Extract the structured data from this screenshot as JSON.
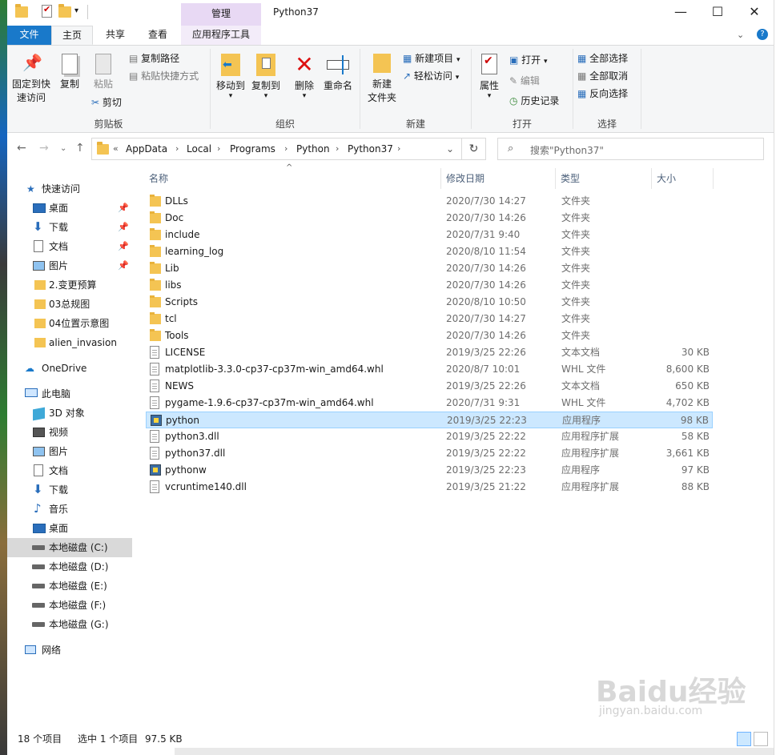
{
  "window": {
    "title": "Python37",
    "context_tab_header": "管理",
    "buttons": {
      "minimize": "—",
      "maximize": "☐",
      "close": "✕"
    }
  },
  "tabs": [
    {
      "label": "文件"
    },
    {
      "label": "主页"
    },
    {
      "label": "共享"
    },
    {
      "label": "查看"
    },
    {
      "label": "应用程序工具"
    }
  ],
  "ribbon": {
    "clipboard": {
      "pin": "固定到快\n速访问",
      "copy": "复制",
      "paste": "粘贴",
      "copy_path": "复制路径",
      "paste_shortcut": "粘贴快捷方式",
      "cut": "剪切",
      "label": "剪贴板"
    },
    "organize": {
      "move_to": "移动到",
      "copy_to": "复制到",
      "delete": "删除",
      "rename": "重命名",
      "label": "组织"
    },
    "new": {
      "new_folder": "新建\n文件夹",
      "new_item": "新建项目",
      "easy_access": "轻松访问",
      "label": "新建"
    },
    "open": {
      "properties": "属性",
      "open": "打开",
      "edit": "编辑",
      "history": "历史记录",
      "label": "打开"
    },
    "select": {
      "select_all": "全部选择",
      "select_none": "全部取消",
      "invert": "反向选择",
      "label": "选择"
    }
  },
  "address": {
    "prefix": "«",
    "crumbs": [
      "AppData",
      "Local",
      "Programs",
      "Python",
      "Python37"
    ],
    "search_placeholder": "搜索\"Python37\""
  },
  "nav": {
    "quick_access": "快速访问",
    "quick_items": [
      {
        "label": "桌面",
        "icon": "desktop-icon",
        "pinned": true
      },
      {
        "label": "下载",
        "icon": "download-icon",
        "pinned": true
      },
      {
        "label": "文档",
        "icon": "document-icon",
        "pinned": true
      },
      {
        "label": "图片",
        "icon": "pictures-icon",
        "pinned": true
      },
      {
        "label": "2.变更预算",
        "icon": "folder-icon",
        "pinned": false
      },
      {
        "label": "03总规图",
        "icon": "folder-icon",
        "pinned": false
      },
      {
        "label": "04位置示意图",
        "icon": "folder-icon",
        "pinned": false
      },
      {
        "label": "alien_invasion",
        "icon": "folder-icon",
        "pinned": false
      }
    ],
    "onedrive": "OneDrive",
    "this_pc": "此电脑",
    "pc_items": [
      {
        "label": "3D 对象",
        "icon": "3d-objects-icon"
      },
      {
        "label": "视频",
        "icon": "video-icon"
      },
      {
        "label": "图片",
        "icon": "pictures-icon"
      },
      {
        "label": "文档",
        "icon": "document-icon"
      },
      {
        "label": "下载",
        "icon": "download-icon"
      },
      {
        "label": "音乐",
        "icon": "music-icon"
      },
      {
        "label": "桌面",
        "icon": "desktop-icon"
      },
      {
        "label": "本地磁盘 (C:)",
        "icon": "drive-icon",
        "selected": true
      },
      {
        "label": "本地磁盘 (D:)",
        "icon": "drive-icon"
      },
      {
        "label": "本地磁盘 (E:)",
        "icon": "drive-icon"
      },
      {
        "label": "本地磁盘 (F:)",
        "icon": "drive-icon"
      },
      {
        "label": "本地磁盘 (G:)",
        "icon": "drive-icon"
      }
    ],
    "network": "网络"
  },
  "columns": {
    "name": "名称",
    "date": "修改日期",
    "type": "类型",
    "size": "大小"
  },
  "files": [
    {
      "name": "DLLs",
      "date": "2020/7/30 14:27",
      "type": "文件夹",
      "size": "",
      "kind": "folder"
    },
    {
      "name": "Doc",
      "date": "2020/7/30 14:26",
      "type": "文件夹",
      "size": "",
      "kind": "folder"
    },
    {
      "name": "include",
      "date": "2020/7/31 9:40",
      "type": "文件夹",
      "size": "",
      "kind": "folder"
    },
    {
      "name": "learning_log",
      "date": "2020/8/10 11:54",
      "type": "文件夹",
      "size": "",
      "kind": "folder"
    },
    {
      "name": "Lib",
      "date": "2020/7/30 14:26",
      "type": "文件夹",
      "size": "",
      "kind": "folder"
    },
    {
      "name": "libs",
      "date": "2020/7/30 14:26",
      "type": "文件夹",
      "size": "",
      "kind": "folder"
    },
    {
      "name": "Scripts",
      "date": "2020/8/10 10:50",
      "type": "文件夹",
      "size": "",
      "kind": "folder"
    },
    {
      "name": "tcl",
      "date": "2020/7/30 14:27",
      "type": "文件夹",
      "size": "",
      "kind": "folder"
    },
    {
      "name": "Tools",
      "date": "2020/7/30 14:26",
      "type": "文件夹",
      "size": "",
      "kind": "folder"
    },
    {
      "name": "LICENSE",
      "date": "2019/3/25 22:26",
      "type": "文本文档",
      "size": "30 KB",
      "kind": "doc"
    },
    {
      "name": "matplotlib-3.3.0-cp37-cp37m-win_amd64.whl",
      "date": "2020/8/7 10:01",
      "type": "WHL 文件",
      "size": "8,600 KB",
      "kind": "doc"
    },
    {
      "name": "NEWS",
      "date": "2019/3/25 22:26",
      "type": "文本文档",
      "size": "650 KB",
      "kind": "doc"
    },
    {
      "name": "pygame-1.9.6-cp37-cp37m-win_amd64.whl",
      "date": "2020/7/31 9:31",
      "type": "WHL 文件",
      "size": "4,702 KB",
      "kind": "doc"
    },
    {
      "name": "python",
      "date": "2019/3/25 22:23",
      "type": "应用程序",
      "size": "98 KB",
      "kind": "exe",
      "selected": true
    },
    {
      "name": "python3.dll",
      "date": "2019/3/25 22:22",
      "type": "应用程序扩展",
      "size": "58 KB",
      "kind": "doc"
    },
    {
      "name": "python37.dll",
      "date": "2019/3/25 22:22",
      "type": "应用程序扩展",
      "size": "3,661 KB",
      "kind": "doc"
    },
    {
      "name": "pythonw",
      "date": "2019/3/25 22:23",
      "type": "应用程序",
      "size": "97 KB",
      "kind": "exe"
    },
    {
      "name": "vcruntime140.dll",
      "date": "2019/3/25 21:22",
      "type": "应用程序扩展",
      "size": "88 KB",
      "kind": "doc"
    }
  ],
  "status": {
    "count": "18 个项目",
    "selected": "选中 1 个项目",
    "size": "97.5 KB"
  },
  "watermark": {
    "main": "Baidu经验",
    "sub": "jingyan.baidu.com"
  }
}
